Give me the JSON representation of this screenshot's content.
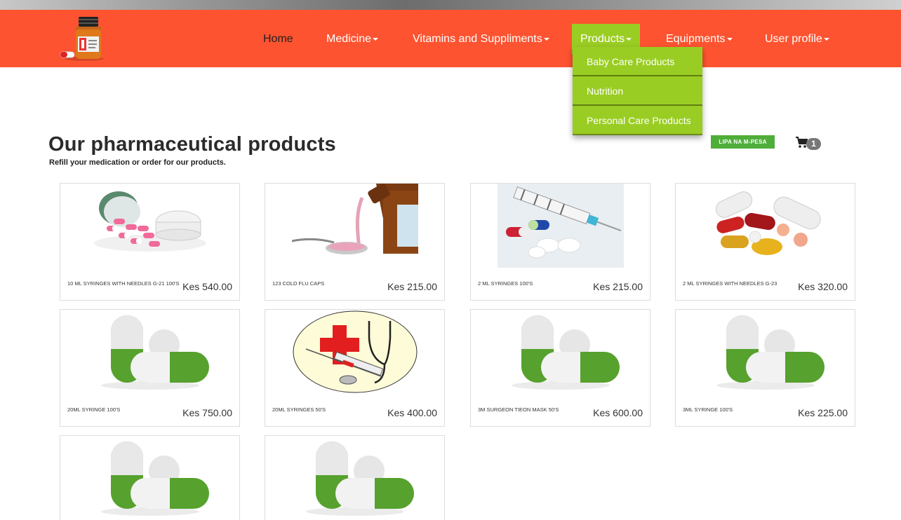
{
  "nav": {
    "items": [
      {
        "label": "Home",
        "caret": false
      },
      {
        "label": "Medicine",
        "caret": true
      },
      {
        "label": "Vitamins and Suppliments",
        "caret": true
      },
      {
        "label": "Products",
        "caret": true,
        "active": true
      },
      {
        "label": "Equipments",
        "caret": true
      },
      {
        "label": "User profile",
        "caret": true
      }
    ],
    "dropdown": [
      "Baby Care Products",
      "Nutrition",
      "Personal Care Products"
    ]
  },
  "header": {
    "title": "Our pharmaceutical products",
    "subtitle": "Refill your medication or order for our products."
  },
  "lipa_label": "LIPA NA M-PESA",
  "cart_count": "1",
  "products": [
    {
      "name": "10 ML SYRINGES WITH NEEDLES G-21 100'S",
      "price": "Kes 540.00",
      "image": "pills-bottle"
    },
    {
      "name": "123 COLD FLU CAPS",
      "price": "Kes 215.00",
      "image": "syrup-spoon"
    },
    {
      "name": "2 ML SYRINGES 100'S",
      "price": "Kes 215.00",
      "image": "syringe-pills"
    },
    {
      "name": "2 ML SYRINGES WITH NEEDLES G-23",
      "price": "Kes 320.00",
      "image": "assorted-pills"
    },
    {
      "name": "20ML SYRINGE 100'S",
      "price": "Kes 750.00",
      "image": "green-capsules"
    },
    {
      "name": "20ML SYRINGES 50's",
      "price": "Kes 400.00",
      "image": "medical-emblem"
    },
    {
      "name": "3M SURGEON TIEON MASK 50'S",
      "price": "Kes 600.00",
      "image": "green-capsules"
    },
    {
      "name": "3ML SYRINGE 100'S",
      "price": "Kes 225.00",
      "image": "green-capsules"
    },
    {
      "name": "",
      "price": "",
      "image": "green-capsules"
    },
    {
      "name": "",
      "price": "",
      "image": "green-capsules"
    }
  ],
  "colors": {
    "navbar": "#fd5330",
    "active": "#9acd23",
    "lipa": "#4fae3a"
  }
}
